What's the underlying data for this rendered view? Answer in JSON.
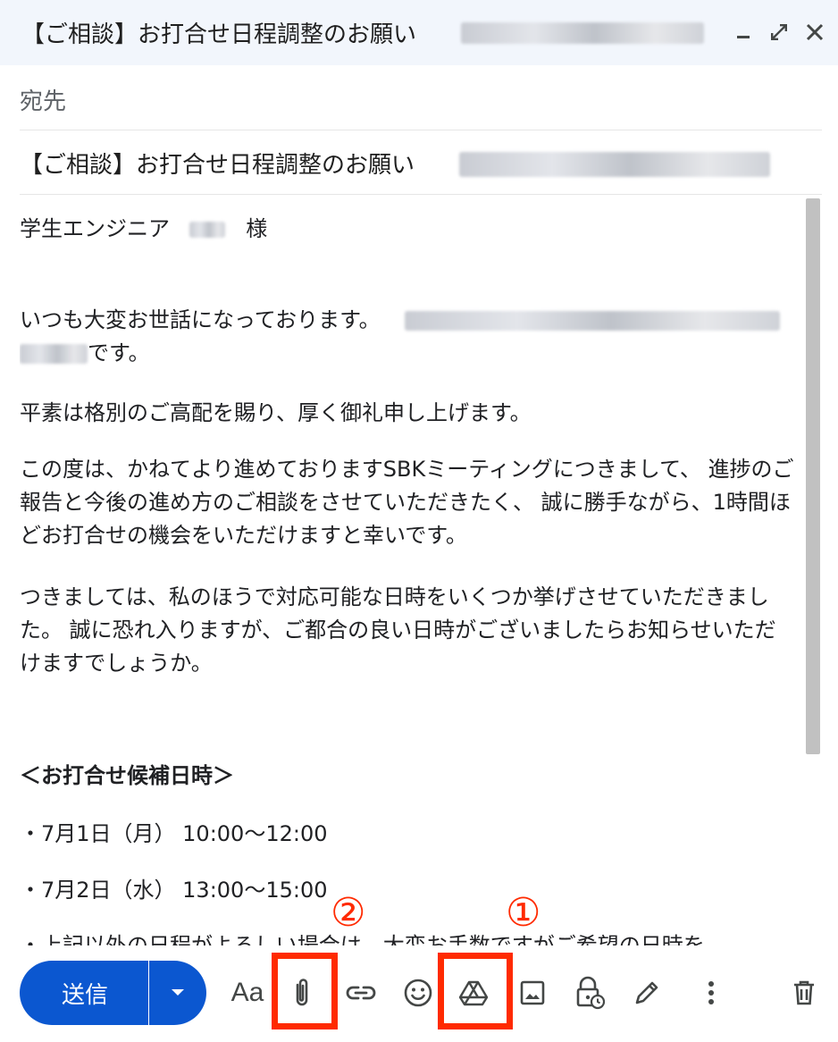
{
  "window": {
    "title": "【ご相談】お打合せ日程調整のお願い"
  },
  "compose": {
    "to_label": "宛先",
    "subject": "【ご相談】お打合せ日程調整のお願い",
    "body": {
      "salutation_prefix": "学生エンジニア",
      "salutation_suffix": "様",
      "greeting_prefix": "いつも大変お世話になっております。",
      "greeting_suffix": "です。",
      "p1": "平素は格別のご高配を賜り、厚く御礼申し上げます。",
      "p2": "この度は、かねてより進めておりますSBKミーティングにつきまして、 進捗のご報告と今後の進め方のご相談をさせていただきたく、 誠に勝手ながら、1時間ほどお打合せの機会をいただけますと幸いです。",
      "p3": "つきましては、私のほうで対応可能な日時をいくつか挙げさせていただきました。 誠に恐れ入りますが、ご都合の良い日時がございましたらお知らせいただけますでしょうか。",
      "heading": "＜お打合せ候補日時＞",
      "slots": [
        "・7月1日（月） 10:00〜12:00",
        "・7月2日（水） 13:00〜15:00"
      ],
      "cut_line": "・上記以外の日程がよろしい場合は、大変お手数ですがご希望の日時を"
    }
  },
  "toolbar": {
    "send_label": "送信",
    "format_label": "Aa",
    "icons": [
      "chevron-down-icon",
      "attach-icon",
      "link-icon",
      "emoji-icon",
      "drive-icon",
      "photo-icon",
      "confidential-icon",
      "signature-icon",
      "more-icon",
      "trash-icon"
    ]
  },
  "annotations": {
    "marker_1": "①",
    "marker_2": "②",
    "color": "#ff2a00"
  },
  "colors": {
    "accent": "#0b57d0",
    "titlebar_bg": "#f2f6fc"
  }
}
